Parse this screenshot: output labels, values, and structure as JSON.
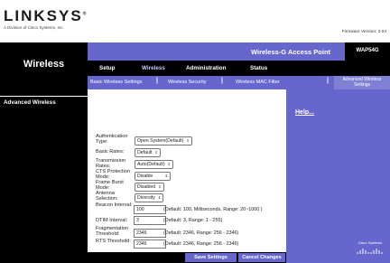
{
  "header": {
    "logo": "LINKSYS",
    "logo_reg": "®",
    "logo_sub": "A Division of Cisco Systems, Inc.",
    "firmware": "Firmware Version: 3.04"
  },
  "title_bar": {
    "section": "Wireless",
    "product": "Wireless-G Access Point",
    "model": "WAP54G"
  },
  "tabs": [
    {
      "label": "Setup",
      "active": false
    },
    {
      "label": "Wireless",
      "active": true
    },
    {
      "label": "Administration",
      "active": false
    },
    {
      "label": "Status",
      "active": false
    }
  ],
  "subtabs": [
    {
      "label": "Basic Wireless Settings"
    },
    {
      "label": "Wireless Security"
    },
    {
      "label": "Wireless MAC Filter"
    },
    {
      "label": "Advanced Wireless Settings"
    }
  ],
  "left": {
    "section_label": "Advanced Wireless"
  },
  "form": {
    "auth_type": {
      "label": "Authentication Type:",
      "value": "Open System(Default)"
    },
    "basic_rates": {
      "label": "Basic Rates:",
      "value": "Default"
    },
    "tx_rates": {
      "label": "Transmission Rates:",
      "value": "Auto(Default)"
    },
    "cts_mode": {
      "label": "CTS Protection Mode:",
      "value": "Disable"
    },
    "frame_burst": {
      "label": "Frame Burst Mode:",
      "value": "Disabled"
    },
    "antenna": {
      "label": "Antenna Selection:",
      "value": "Diversity"
    },
    "beacon": {
      "label": "Beacon Interval:",
      "value": "100",
      "hint": "(Default: 100, Milliseconds, Range: 20~1000 )"
    },
    "dtim": {
      "label": "DTIM Interval:",
      "value": "3",
      "hint": "(Default: 3, Range: 1 - 255)"
    },
    "frag": {
      "label": "Fragmentation Threshold:",
      "value": "2346",
      "hint": "(Default: 2346, Range: 256 - 2346)"
    },
    "rts": {
      "label": "RTS Threshold:",
      "value": "2346",
      "hint": "(Default: 2346, Range: 256 - 2346)"
    }
  },
  "right": {
    "help": "Help...",
    "cisco": "Cisco Systems"
  },
  "buttons": {
    "save": "Save Settings",
    "cancel": "Cancel Changes"
  },
  "colors": {
    "accent": "#6666cc",
    "dark": "#000000"
  }
}
